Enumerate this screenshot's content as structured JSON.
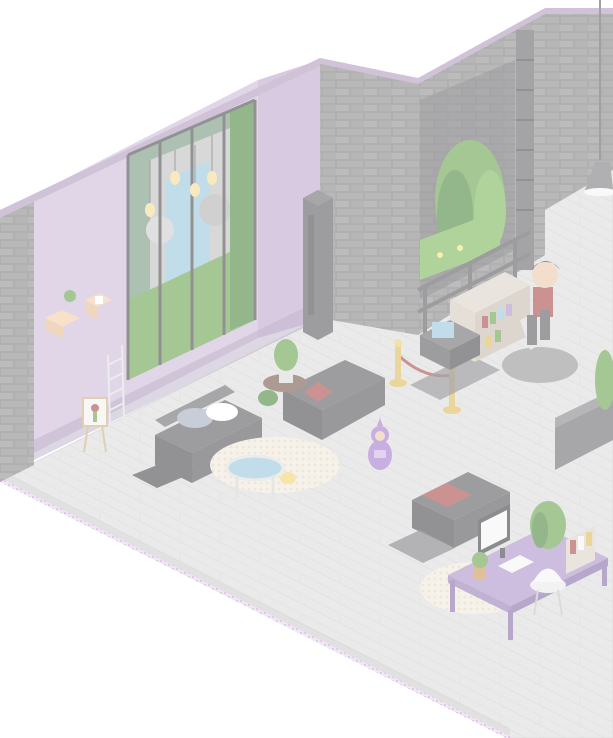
{
  "scene": {
    "name": "isometric-room",
    "faded": true,
    "colors": {
      "wall_purple": "#c9b3d6",
      "wall_purple_dark": "#a992b8",
      "wall_trim": "#8f7aa6",
      "brick": "#707070",
      "brick_light": "#8a8a8a",
      "brick_mortar": "#5b5b5b",
      "floor_plank": "#d9d9d9",
      "floor_plank_dark": "#c4c4c4",
      "floor_edge": "#bdbdbd",
      "edge_dots": "#c59bd6",
      "sofa": "#4d4d52",
      "sofa_dark": "#3a3a3e",
      "pillow_red": "#a23a3a",
      "rug_shag": "#eee8d8",
      "rug_dark": "#5d5d62",
      "plant_green": "#5a9a3c",
      "plant_dark": "#3c7a2c",
      "gold": "#d9b24a",
      "rope_red": "#a33b3b",
      "desk_purple": "#a488c4",
      "teletubby": "#9c6cc9",
      "water": "#8fc2d8",
      "rock": "#b8b8b8"
    },
    "icons": [
      "window-waterfall-icon",
      "lamp-icon",
      "bookshelf-icon",
      "monitor-icon",
      "plant-icon",
      "sofa-icon",
      "coffee-table-icon",
      "easel-icon",
      "ladder-icon",
      "wall-shelf-icon",
      "stanchion-icon",
      "avatar-icon",
      "teletubby-icon",
      "armchair-icon",
      "fireplace-icon"
    ]
  }
}
